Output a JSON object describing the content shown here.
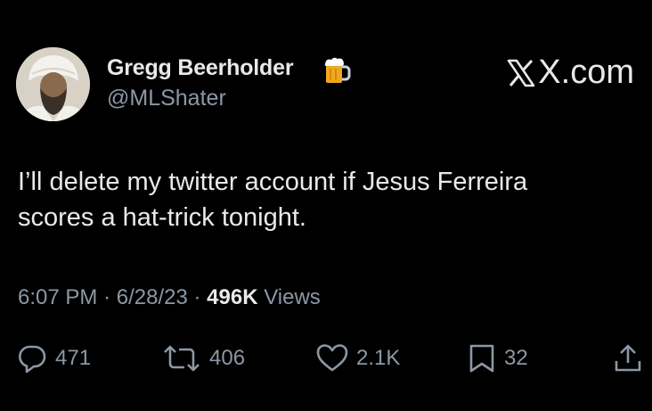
{
  "user": {
    "display_name": "Gregg Beerholder",
    "name_emoji_icon": "beer-mug-icon",
    "handle": "@MLShater"
  },
  "brand": {
    "label": "X.com",
    "icon": "x-logo-icon"
  },
  "tweet": {
    "text_lines": [
      "I’ll delete my twitter account if Jesus Ferreira",
      "scores a hat-trick tonight."
    ]
  },
  "meta": {
    "time": "6:07 PM",
    "separator": "·",
    "date": "6/28/23",
    "views_count": "496K",
    "views_label": "Views"
  },
  "actions": {
    "reply": {
      "icon": "reply-icon",
      "count": "471"
    },
    "retweet": {
      "icon": "retweet-icon",
      "count": "406"
    },
    "like": {
      "icon": "heart-icon",
      "count": "2.1K"
    },
    "bookmark": {
      "icon": "bookmark-icon",
      "count": "32"
    },
    "share": {
      "icon": "share-icon"
    }
  },
  "colors": {
    "background": "#000000",
    "primary_text": "#e7e9ea",
    "secondary_text": "#8b98a5"
  }
}
